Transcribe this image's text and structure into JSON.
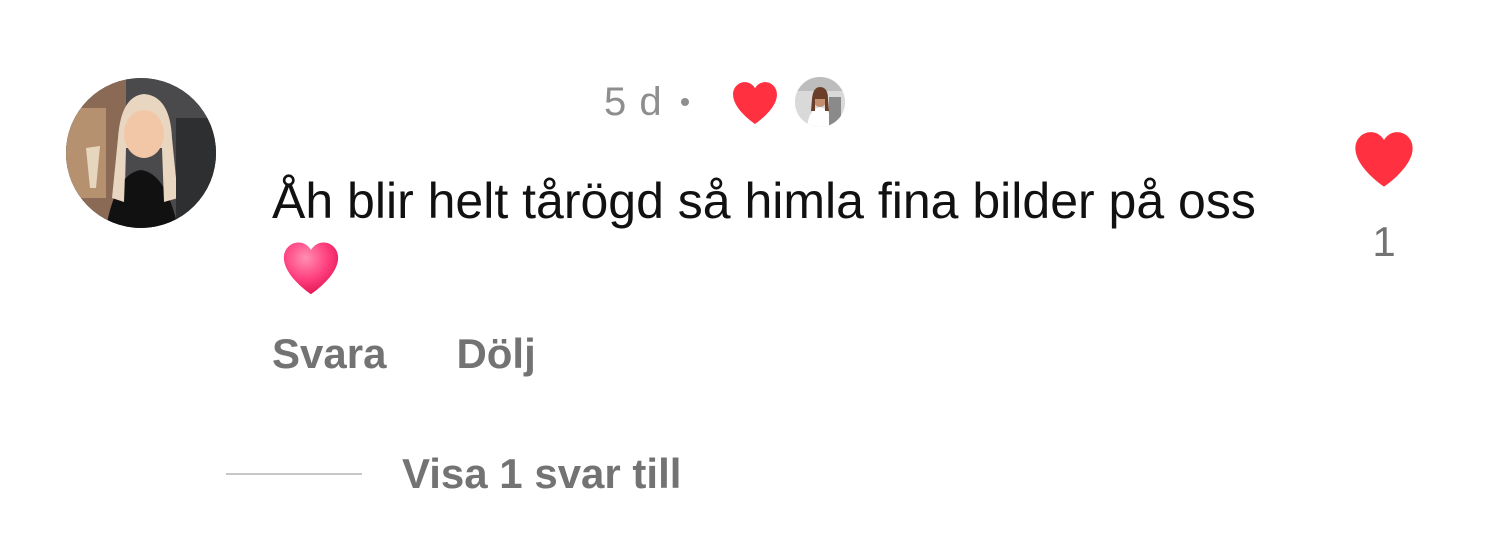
{
  "comment": {
    "avatar_icon": "user-avatar",
    "timestamp": "5 d",
    "creator_liked_icon": "heart-icon",
    "creator_like_color": "#ff3040",
    "text": "Åh blir helt tårögd så himla fina bilder på oss",
    "emoji": "heart-emoji",
    "emoji_color": "#ff2d6f",
    "actions": {
      "reply_label": "Svara",
      "hide_label": "Dölj"
    },
    "like": {
      "icon": "heart-icon",
      "color": "#ff3040",
      "count": "1"
    },
    "replies_label": "Visa 1 svar till"
  }
}
